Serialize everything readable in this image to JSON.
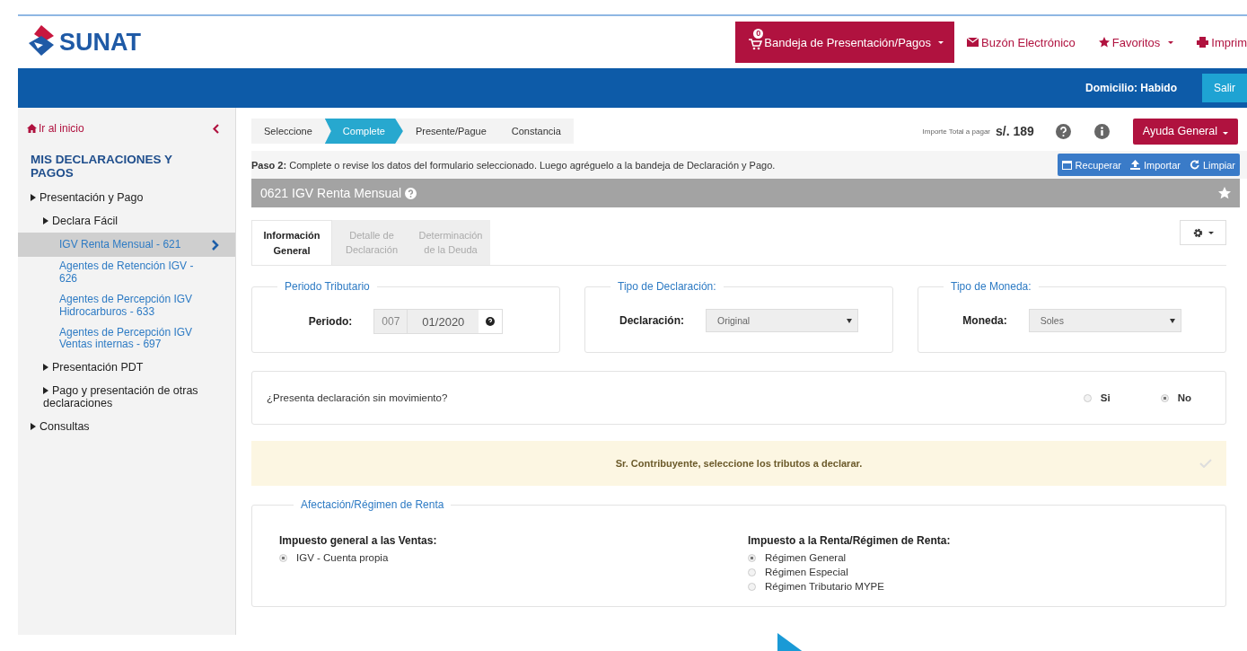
{
  "header": {
    "logo": "SUNAT",
    "nav": [
      {
        "kind": "tray",
        "label": "Bandeja de Presentación/Pagos",
        "badge": "0",
        "dropdown": true
      },
      {
        "kind": "mail",
        "label": "Buzón Electrónico",
        "dropdown": false
      },
      {
        "kind": "star",
        "label": "Favoritos",
        "dropdown": true
      },
      {
        "kind": "print",
        "label": "Imprim",
        "dropdown": false
      }
    ]
  },
  "status_bar": {
    "address": "Domicilio: Habido",
    "logout": "Salir"
  },
  "sidebar": {
    "home": "Ir al inicio",
    "title": "MIS DECLARACIONES Y PAGOS",
    "items": [
      {
        "kind": "group",
        "label": "Presentación y Pago",
        "children": [
          {
            "kind": "group",
            "label": "Declara Fácil",
            "children": [
              {
                "kind": "form",
                "label": "IGV Renta Mensual - 621",
                "selected": true
              },
              {
                "kind": "form",
                "label": "Agentes de Retención IGV - 626",
                "selected": false
              },
              {
                "kind": "form",
                "label": "Agentes de Percepción IGV Hidrocarburos - 633",
                "selected": false
              },
              {
                "kind": "form",
                "label": "Agentes de Percepción IGV Ventas internas - 697",
                "selected": false
              }
            ]
          },
          {
            "kind": "group",
            "label": "Presentación PDT"
          },
          {
            "kind": "group",
            "label": "Pago y presentación de otras declaraciones"
          }
        ]
      },
      {
        "kind": "group",
        "label": "Consultas"
      }
    ]
  },
  "steps": [
    {
      "label": "Seleccione",
      "selected": false
    },
    {
      "label": "Complete",
      "selected": true
    },
    {
      "label": "Presente/Pague",
      "selected": false
    },
    {
      "label": "Constancia",
      "selected": false
    }
  ],
  "total": {
    "label": "Importe Total a pagar",
    "amount": "s/. 189"
  },
  "help_button": "Ayuda General",
  "instruction": "**Paso 2:** Complete o revise los datos del formulario seleccionado. Luego agréguelo a la bandeja de Declaración y Pago.",
  "toolbar": [
    {
      "kind": "calendar",
      "label": "Recuperar"
    },
    {
      "kind": "upload",
      "label": "Importar"
    },
    {
      "kind": "refresh",
      "label": "Limpiar"
    }
  ],
  "form": {
    "title": "0621 IGV Renta Mensual",
    "tabs": [
      {
        "label": "Información General",
        "selected": true
      },
      {
        "label": "Detalle de Declaración",
        "selected": false
      },
      {
        "label": "Determinación de la Deuda",
        "selected": false
      }
    ],
    "period": {
      "legend": "Periodo Tributario",
      "label": "Periodo:",
      "code": "007",
      "value": "01/2020"
    },
    "declaration": {
      "legend": "Tipo de Declaración:",
      "label": "Declaración:",
      "value": "Original"
    },
    "currency": {
      "legend": "Tipo de Moneda:",
      "label": "Moneda:",
      "value": "Soles"
    },
    "no_movement": {
      "question": "¿Presenta declaración sin movimiento?",
      "options": [
        {
          "label": "Si",
          "selected": false
        },
        {
          "label": "No",
          "selected": true
        }
      ]
    },
    "alert": "Sr. Contribuyente, seleccione los tributos a declarar.",
    "regime": {
      "legend": "Afectación/Régimen de Renta",
      "groups": [
        {
          "title": "Impuesto general a las Ventas:",
          "options": [
            {
              "label": "IGV - Cuenta propia",
              "selected": true
            }
          ]
        },
        {
          "title": "Impuesto a la Renta/Régimen de Renta:",
          "options": [
            {
              "label": "Régimen General",
              "selected": true
            },
            {
              "label": "Régimen Especial",
              "selected": false
            },
            {
              "label": "Régimen Tributario MYPE",
              "selected": false
            }
          ]
        }
      ]
    }
  }
}
